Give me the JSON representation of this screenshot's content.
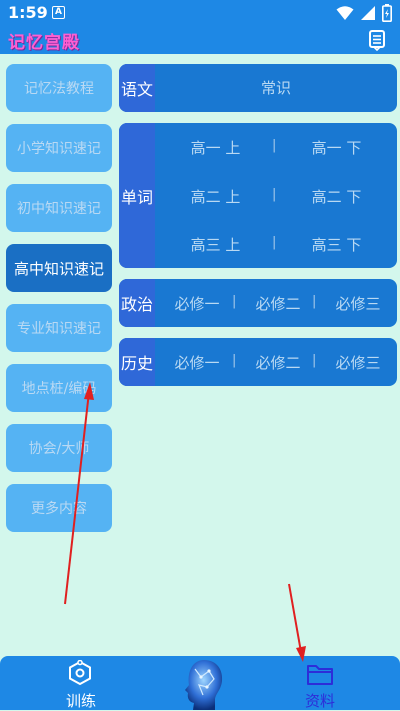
{
  "status": {
    "time": "1:59",
    "notif": "A"
  },
  "app": {
    "title": "记忆宫殿"
  },
  "left_menu": [
    {
      "label": "记忆法教程"
    },
    {
      "label": "小学知识速记"
    },
    {
      "label": "初中知识速记"
    },
    {
      "label": "高中知识速记",
      "active": true
    },
    {
      "label": "专业知识速记"
    },
    {
      "label": "地点桩/编码"
    },
    {
      "label": "协会/大师"
    },
    {
      "label": "更多内容"
    }
  ],
  "panels": {
    "yuwen": {
      "head": "语文",
      "item": "常识"
    },
    "danci": {
      "head": "单词",
      "rows": [
        [
          "高一 上",
          "高一 下"
        ],
        [
          "高二 上",
          "高二 下"
        ],
        [
          "高三 上",
          "高三 下"
        ]
      ]
    },
    "zhengzhi": {
      "head": "政治",
      "items": [
        "必修一",
        "必修二",
        "必修三"
      ]
    },
    "lishi": {
      "head": "历史",
      "items": [
        "必修一",
        "必修二",
        "必修三"
      ]
    }
  },
  "bottom_nav": {
    "train": "训练",
    "materials": "资料"
  },
  "colors": {
    "accent": "#1e88e5",
    "background": "#d3f7ec",
    "active_nav": "#2d2dd9",
    "arrow": "#e02020"
  }
}
